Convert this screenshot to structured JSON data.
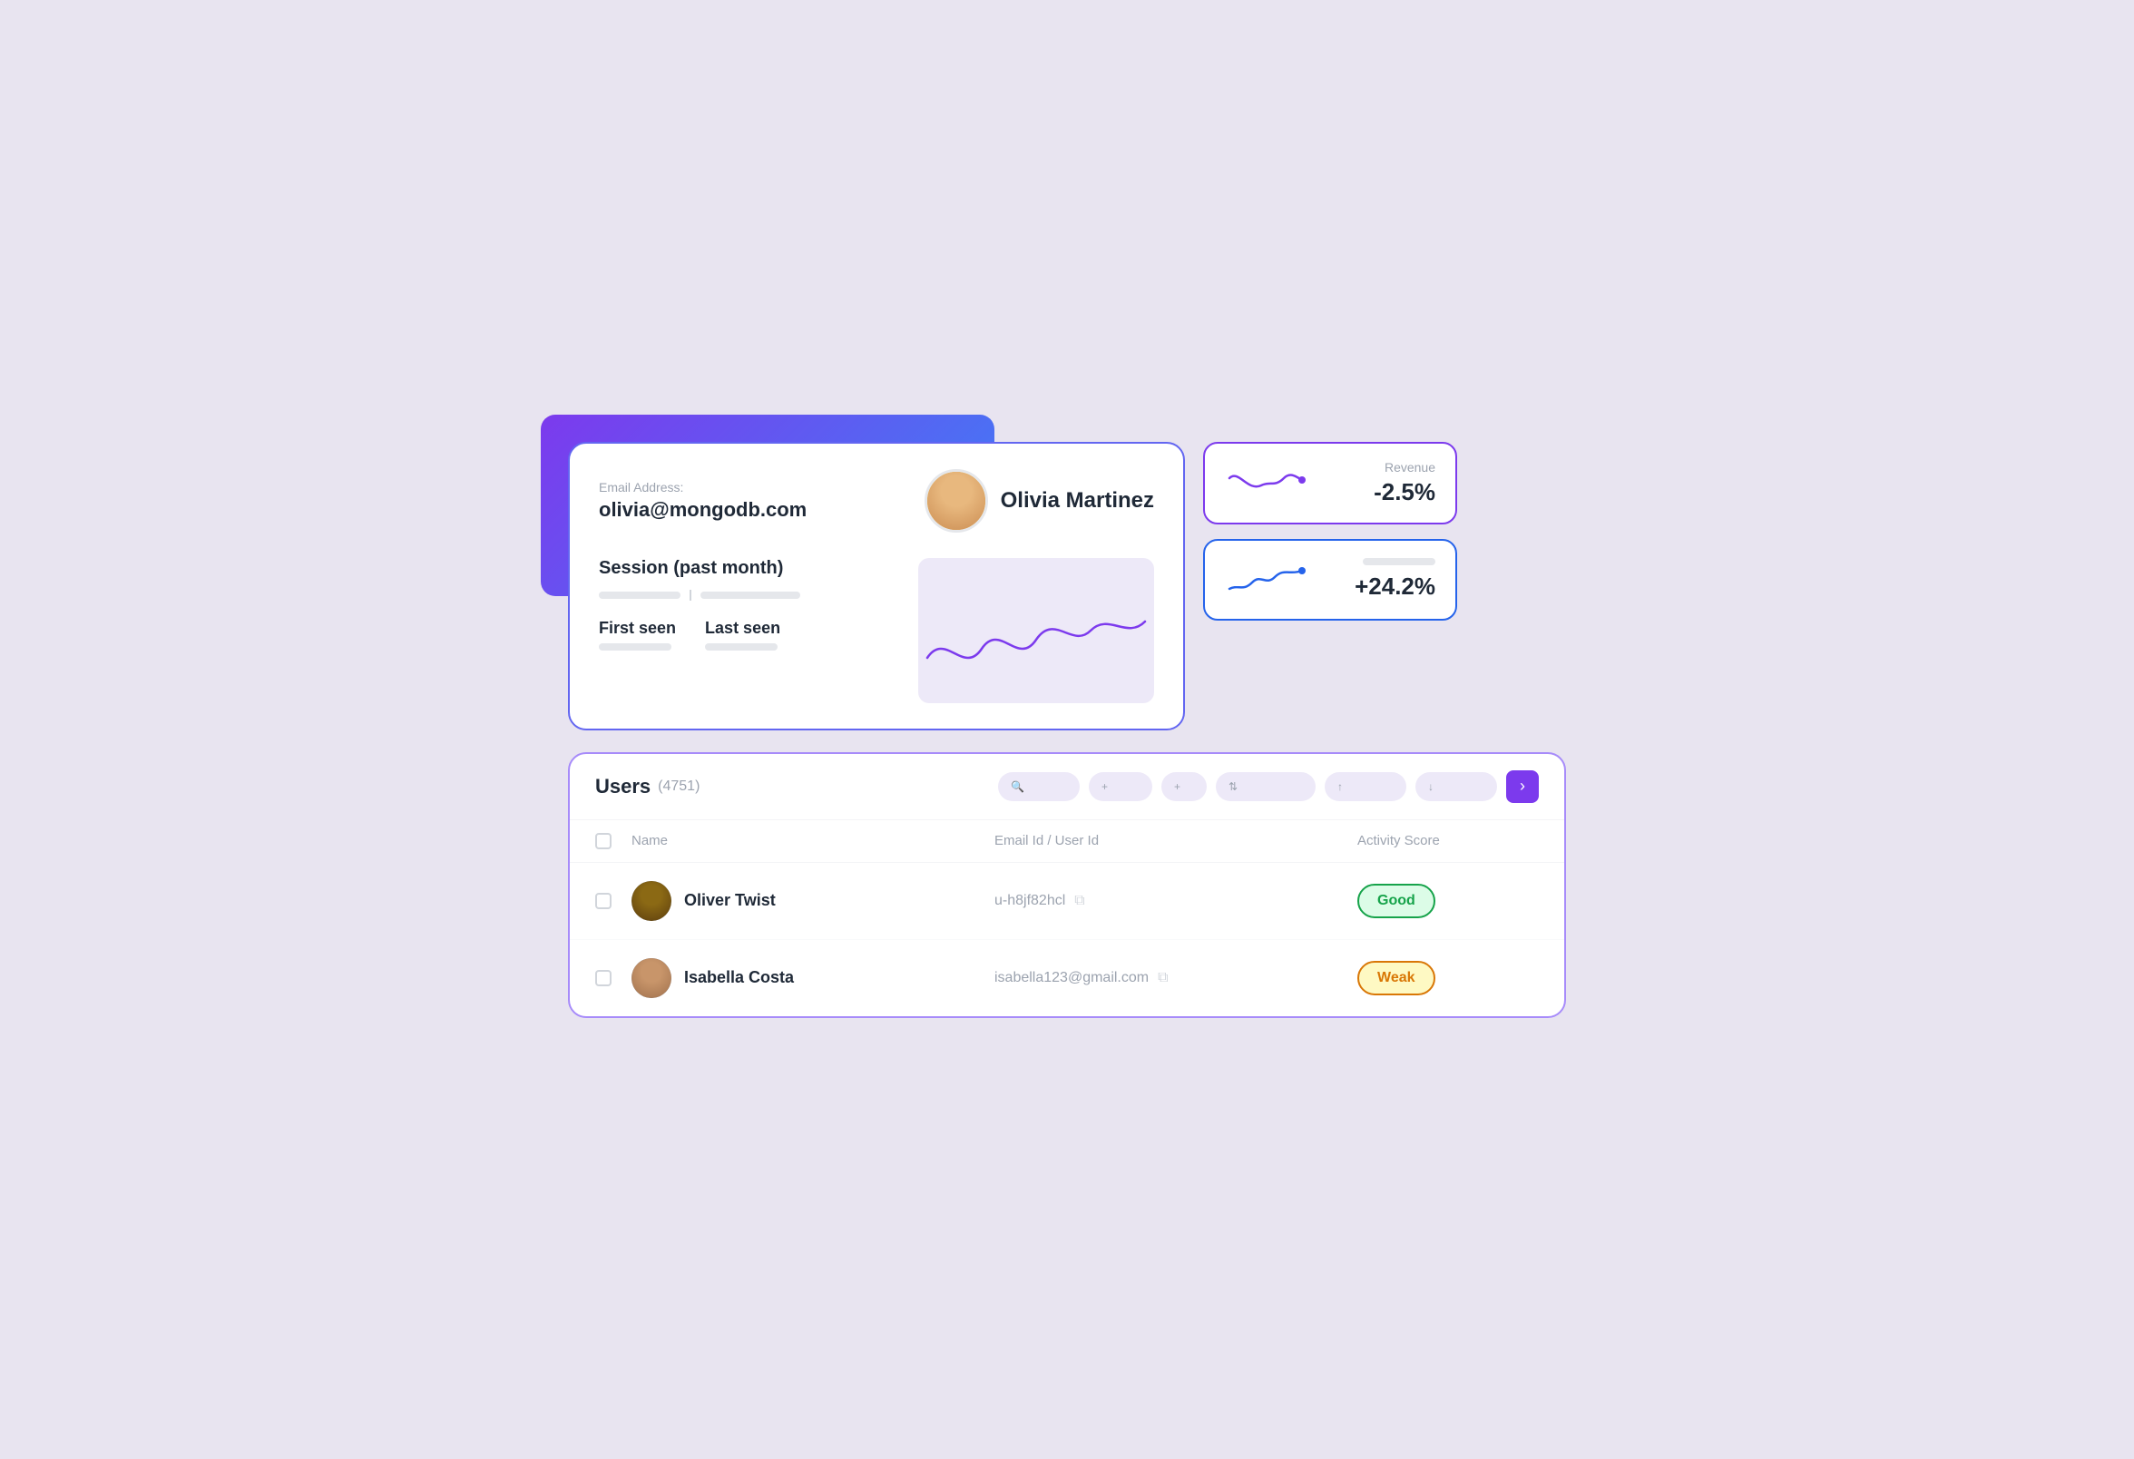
{
  "background": {
    "color": "#e8e4f0"
  },
  "user_profile_card": {
    "email_label": "Email Address:",
    "email_value": "olivia@mongodb.com",
    "user_name": "Olivia Martinez",
    "session_title": "Session (past month)",
    "first_seen_label": "First seen",
    "last_seen_label": "Last seen"
  },
  "metric_cards": [
    {
      "label": "Revenue",
      "value": "-2.5%",
      "color": "#7c3aed"
    },
    {
      "label": "",
      "value": "+24.2%",
      "color": "#2563eb"
    }
  ],
  "users_table": {
    "title": "Users",
    "count": "(4751)",
    "columns": [
      "Name",
      "Email Id / User Id",
      "Activity Score"
    ],
    "rows": [
      {
        "name": "Oliver Twist",
        "email": "u-h8jf82hcl",
        "score": "Good",
        "score_type": "good"
      },
      {
        "name": "Isabella Costa",
        "email": "isabella123@gmail.com",
        "score": "Weak",
        "score_type": "weak"
      }
    ]
  },
  "toolbar": {
    "buttons": [
      "Search",
      "Filter",
      "Add",
      "Sort",
      "Export",
      "Download"
    ]
  }
}
